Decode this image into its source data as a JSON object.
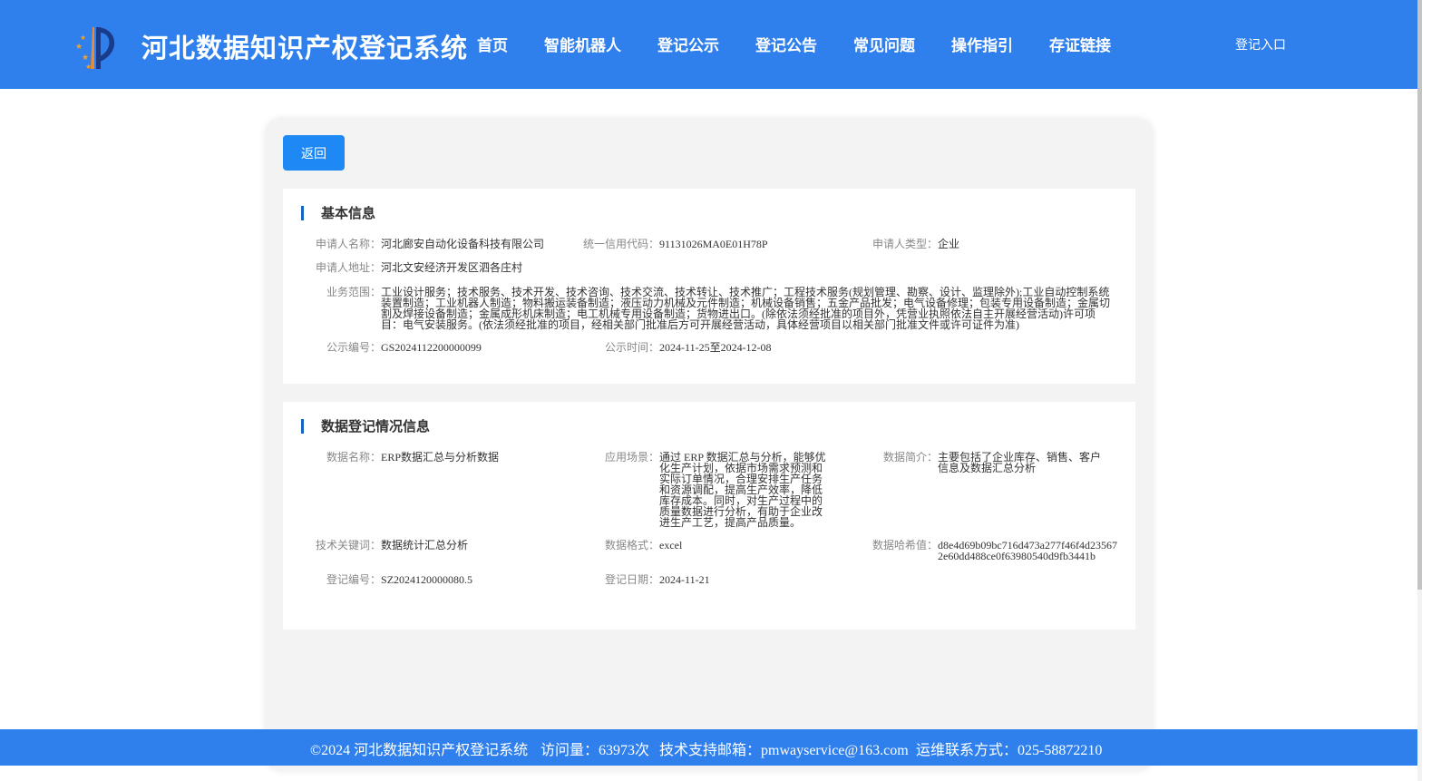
{
  "header": {
    "title": "河北数据知识产权登记系统",
    "nav": [
      "首页",
      "智能机器人",
      "登记公示",
      "登记公告",
      "常见问题",
      "操作指引",
      "存证链接"
    ],
    "login": "登记入口"
  },
  "back_label": "返回",
  "basic": {
    "title": "基本信息",
    "applicant_name_label": "申请人名称：",
    "applicant_name": "河北廊安自动化设备科技有限公司",
    "credit_code_label": "统一信用代码：",
    "credit_code": "91131026MA0E01H78P",
    "applicant_type_label": "申请人类型：",
    "applicant_type": "企业",
    "address_label": "申请人地址：",
    "address": "河北文安经济开发区泗各庄村",
    "scope_label": "业务范围：",
    "scope": "工业设计服务；技术服务、技术开发、技术咨询、技术交流、技术转让、技术推广；工程技术服务(规划管理、勘察、设计、监理除外);工业自动控制系统装置制造；工业机器人制造；物料搬运装备制造；液压动力机械及元件制造；机械设备销售；五金产品批发；电气设备修理；包装专用设备制造；金属切割及焊接设备制造；金属成形机床制造；电工机械专用设备制造；货物进出口。(除依法须经批准的项目外，凭营业执照依法自主开展经营活动)许可项目：电气安装服务。(依法须经批准的项目，经相关部门批准后方可开展经营活动，具体经营项目以相关部门批准文件或许可证件为准)",
    "pub_no_label": "公示编号：",
    "pub_no": "GS2024112200000099",
    "pub_time_label": "公示时间：",
    "pub_time": "2024-11-25至2024-12-08"
  },
  "data_info": {
    "title": "数据登记情况信息",
    "name_label": "数据名称：",
    "name": "ERP数据汇总与分析数据",
    "scene_label": "应用场景：",
    "scene": "通过 ERP 数据汇总与分析，能够优化生产计划，依据市场需求预测和实际订单情况，合理安排生产任务和资源调配，提高生产效率，降低库存成本。同时，对生产过程中的质量数据进行分析，有助于企业改进生产工艺，提高产品质量。",
    "intro_label": "数据简介：",
    "intro": "主要包括了企业库存、销售、客户信息及数据汇总分析",
    "keywords_label": "技术关键词：",
    "keywords": "数据统计汇总分析",
    "format_label": "数据格式：",
    "format": "excel",
    "hash_label": "数据哈希值：",
    "hash": "d8e4d69b09bc716d473a277f46f4d235672e60dd488ce0f63980540d9fb3441b",
    "reg_no_label": "登记编号：",
    "reg_no": "SZ2024120000080.5",
    "reg_date_label": "登记日期：",
    "reg_date": "2024-11-21"
  },
  "footer": {
    "copyright": "©2024 河北数据知识产权登记系统",
    "visits": "访问量：63973次",
    "email": "技术支持邮箱：pmwayservice@163.com",
    "phone": "运维联系方式：025-58872210"
  },
  "colors": {
    "header_bg": "#2f80ed",
    "button_bg": "#1e88f5",
    "title_bar": "#1565c0"
  }
}
